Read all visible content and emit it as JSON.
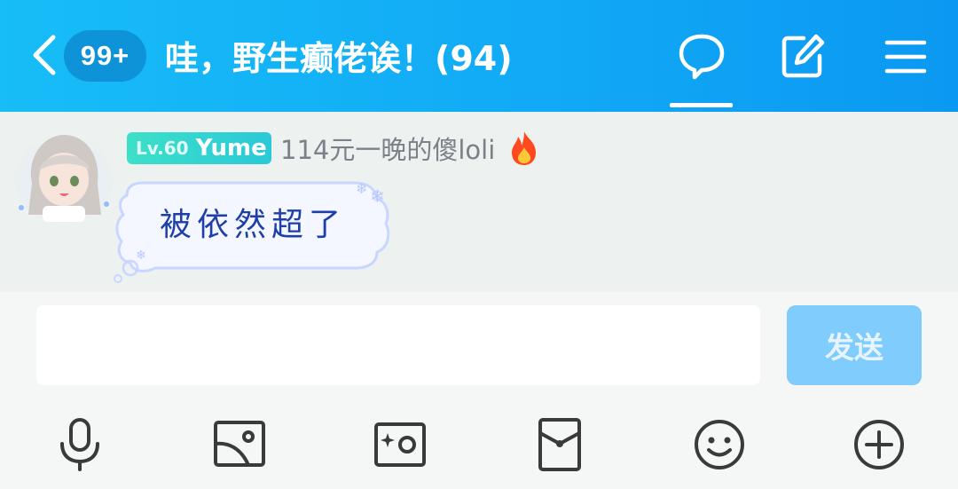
{
  "header": {
    "back_icon": "chevron-left-icon",
    "unread_badge": "99+",
    "title": "哇，野生癫佬诶！(94)",
    "icons": [
      "chat-bubble-icon",
      "edit-icon",
      "menu-icon"
    ],
    "gradient_colors": [
      "#17bdf7",
      "#0b98f2"
    ]
  },
  "message": {
    "avatar": "avatar",
    "level_prefix": "Lv.60",
    "level_name": "Yume",
    "sender_name": "114元一晚的傻loli",
    "flair_icon": "fire-icon",
    "text": "被依然超了",
    "text_color": "#1e3fa8"
  },
  "composer": {
    "input_value": "",
    "send_label": "发送",
    "send_color": "#80ccfc"
  },
  "toolbar": {
    "icons": [
      "microphone-icon",
      "image-icon",
      "photo-album-icon",
      "red-packet-icon",
      "emoji-icon",
      "plus-icon"
    ]
  }
}
